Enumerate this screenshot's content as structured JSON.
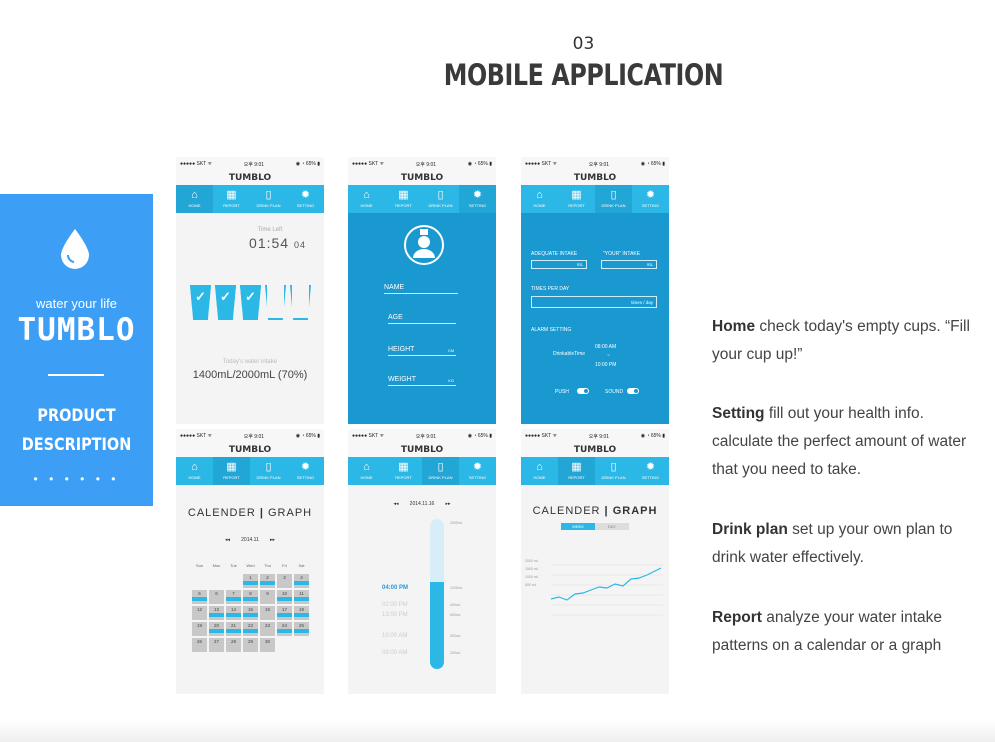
{
  "header": {
    "number": "03",
    "title": "MOBILE APPLICATION"
  },
  "side": {
    "tagline": "water your life",
    "logo": "TUMBLO",
    "product": "PRODUCT",
    "description": "DESCRIPTION",
    "dots": "• • • • • •"
  },
  "phone": {
    "status_left": "●●●●● SKT ᯤ",
    "status_center": "오후 9:01",
    "status_right": "◉ ◔ 65% ▮",
    "app_title": "TUMBLO",
    "tabs": [
      "HOME",
      "REPORT",
      "DRINK PLAN",
      "SETTING"
    ]
  },
  "home": {
    "time_left_label": "Time Left",
    "time_left": "01:54",
    "time_left_seconds": "04",
    "intake_label": "Today's water intake",
    "intake": "1400mL/2000mL (70%)",
    "cups_filled": 3,
    "cups_total": 5
  },
  "setting": {
    "fields": [
      "NAME",
      "AGE",
      "HEIGHT",
      "WEIGHT"
    ],
    "units": [
      "",
      "",
      "CM",
      "KG"
    ]
  },
  "plan": {
    "adequate_label": "ADEQUATE INTAKE",
    "your_label": "\"YOUR\" INTAKE",
    "ml": "mL",
    "times_label": "TIMES PER DAY",
    "times_unit": "times / day",
    "alarm_label": "ALARM SETTING",
    "drinkable_label": "DrinkableTime",
    "alarm_start": "08:00 AM",
    "alarm_sep": "~",
    "alarm_end": "10:00 PM",
    "push": "PUSH",
    "sound": "SOUND"
  },
  "report_calendar": {
    "head_a": "CALENDER",
    "sep": "|",
    "head_b": "GRAPH",
    "prev": "◂◂",
    "month": "2014.11",
    "next": "▸▸",
    "weekdays": [
      "Sun",
      "Mon",
      "Tue",
      "Wed",
      "Thu",
      "Fri",
      "Sat"
    ],
    "days": [
      "",
      "",
      "",
      "1",
      "2",
      "3",
      "4",
      "5",
      "6",
      "7",
      "8",
      "9",
      "10",
      "11",
      "12",
      "13",
      "14",
      "15",
      "16",
      "17",
      "18",
      "19",
      "20",
      "21",
      "22",
      "23",
      "24",
      "25",
      "26",
      "27",
      "28",
      "29",
      "30",
      "",
      "",
      "",
      ""
    ]
  },
  "drink_plan_screen": {
    "prev": "◂◂",
    "date": "2014.11.16",
    "next": "▸▸",
    "max": "2000mL",
    "times": [
      "04:00 PM",
      "02:00 PM",
      "13:00 PM",
      "10:00 AM",
      "08:00 AM"
    ],
    "vols": [
      "1200mL",
      "400mL",
      "600mL",
      "300mL",
      "200mL"
    ]
  },
  "report_graph": {
    "head_a": "CALENDER",
    "sep": "|",
    "head_b": "GRAPH",
    "tab_week": "WEEK",
    "tab_day": "DAY",
    "y_ticks": [
      "2000 mL",
      "1500 mL",
      "1000 mL",
      "500 mL"
    ]
  },
  "descriptions": [
    {
      "term": "Home",
      "text": " check today's empty cups. “Fill your cup up!”"
    },
    {
      "term": "Setting",
      "text": " fill out your health info. calculate the perfect amount of water that you need to take."
    },
    {
      "term": "Drink plan",
      "text": "  set up your own plan to drink water effectively."
    },
    {
      "term": "Report",
      "text": " analyze your water intake patterns on a calendar or a graph"
    }
  ],
  "colors": {
    "panel": "#3d9ef5",
    "tab_bar": "#2bb8e6",
    "setting_bg": "#1a98d0"
  }
}
